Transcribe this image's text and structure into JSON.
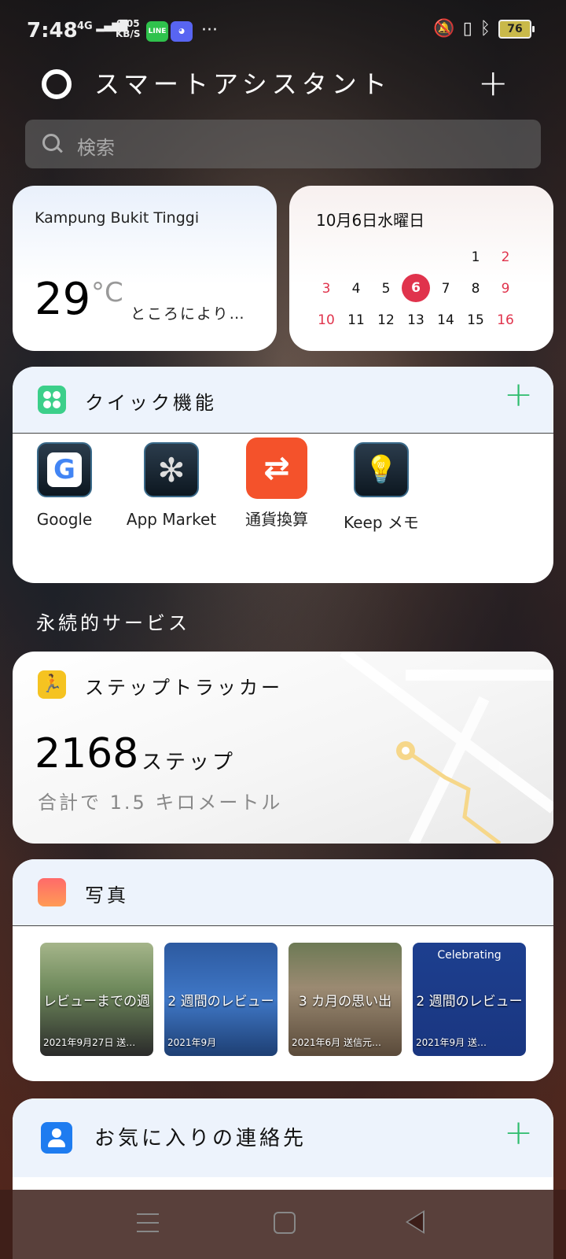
{
  "status_bar": {
    "time": "7:48",
    "network": "4G",
    "speed_value": "0.05",
    "speed_unit": "KB/S",
    "line_icon": "LINE",
    "more": "···",
    "battery": "76"
  },
  "header": {
    "title": "スマートアシスタント",
    "add": "+"
  },
  "search": {
    "placeholder": "検索"
  },
  "weather": {
    "location": "Kampung Bukit Tinggi",
    "temperature": "29",
    "unit": "°C",
    "description": "ところにより…"
  },
  "calendar": {
    "date_label": "10月6日水曜日",
    "week1": [
      "",
      "",
      "",
      "",
      "",
      "1",
      "2"
    ],
    "week2": [
      "3",
      "4",
      "5",
      "6",
      "7",
      "8",
      "9"
    ],
    "week3": [
      "10",
      "11",
      "12",
      "13",
      "14",
      "15",
      "16"
    ],
    "today": "6",
    "accent_color": "#e0334c"
  },
  "quick": {
    "title": "クイック機能",
    "add": "+",
    "apps": [
      {
        "label": "Google",
        "icon": "google-icon"
      },
      {
        "label": "App Market",
        "icon": "app-market-icon"
      },
      {
        "label": "通貨換算",
        "icon": "currency-convert-icon"
      },
      {
        "label": "Keep メモ",
        "icon": "keep-notes-icon"
      }
    ]
  },
  "section_label": "永続的サービス",
  "steps": {
    "title": "ステップトラッカー",
    "count": "2168",
    "unit": "ステップ",
    "distance": "合計で 1.5 キロメートル"
  },
  "photos": {
    "title": "写真",
    "items": [
      {
        "caption": "レビューまでの週",
        "date": "2021年9月27日 送…"
      },
      {
        "caption": "2 週間のレビュー",
        "date": "2021年9月"
      },
      {
        "caption": "3 カ月の思い出",
        "date": "2021年6月 送信元…"
      },
      {
        "caption": "2 週間のレビュー",
        "date": "2021年9月 送…",
        "banner": "Celebrating"
      }
    ]
  },
  "contacts": {
    "title": "お気に入りの連絡先",
    "add": "+"
  }
}
